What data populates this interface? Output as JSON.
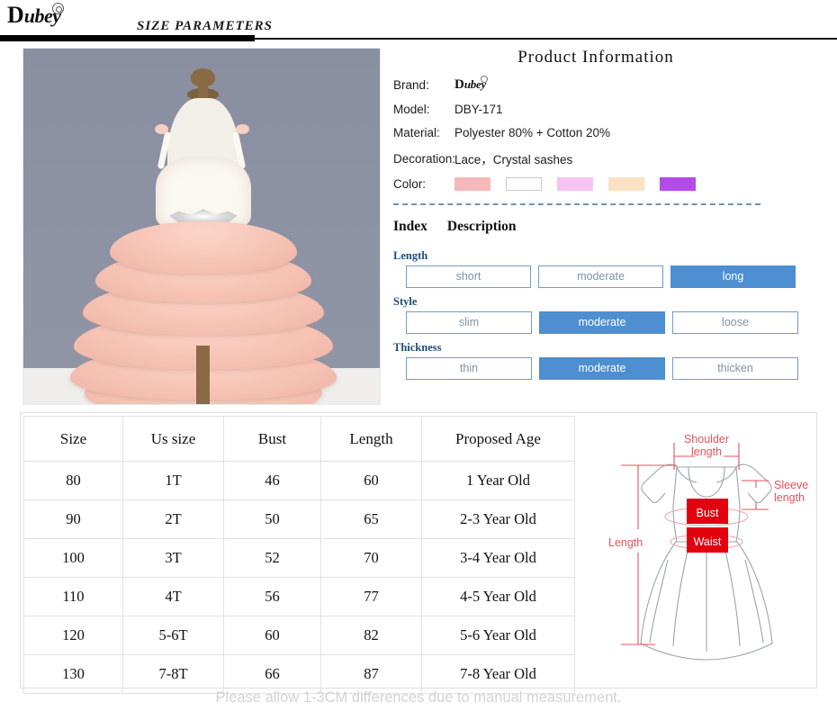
{
  "header": {
    "brand_logo_first": "D",
    "brand_logo_rest": "ubey",
    "title": "SIZE  PARAMETERS"
  },
  "product_image": {
    "alt": "pink tiered tulle flower girl dress on mannequin"
  },
  "product_information": {
    "title": "Product  Information",
    "specs": [
      {
        "label": "Brand:",
        "value": "Dubey",
        "is_logo": true
      },
      {
        "label": "Model:",
        "value": "DBY-171"
      },
      {
        "label": "Material:",
        "value": "Polyester 80% + Cotton 20%"
      },
      {
        "label": "Decoration:",
        "value": "Lace，Crystal sashes"
      }
    ],
    "color_label": "Color:",
    "colors": [
      {
        "name": "pink",
        "hex": "#f6b8bb",
        "border": "#f6b8bb"
      },
      {
        "name": "white",
        "hex": "#ffffff",
        "border": "#c9c9c9"
      },
      {
        "name": "light-magenta",
        "hex": "#f7c3f5",
        "border": "#f7c3f5"
      },
      {
        "name": "peach",
        "hex": "#fbe0c4",
        "border": "#fbe0c4"
      },
      {
        "name": "purple",
        "hex": "#b44ae8",
        "border": "#b44ae8"
      }
    ]
  },
  "index_description": {
    "index_label": "Index",
    "description_label": "Description",
    "groups": [
      {
        "label": "Length",
        "options": [
          {
            "label": "short",
            "selected": false
          },
          {
            "label": "moderate",
            "selected": false
          },
          {
            "label": "long",
            "selected": true
          }
        ]
      },
      {
        "label": "Style",
        "options": [
          {
            "label": "slim",
            "selected": false
          },
          {
            "label": "moderate",
            "selected": true
          },
          {
            "label": "loose",
            "selected": false
          }
        ]
      },
      {
        "label": "Thickness",
        "options": [
          {
            "label": "thin",
            "selected": false
          },
          {
            "label": "moderate",
            "selected": true
          },
          {
            "label": "thicken",
            "selected": false
          }
        ]
      }
    ],
    "accent_color": "#4d8fd1",
    "label_color": "#1f4e79"
  },
  "size_table": {
    "columns": [
      "Size",
      "Us size",
      "Bust",
      "Length",
      "Proposed Age"
    ],
    "rows": [
      [
        "80",
        "1T",
        "46",
        "60",
        "1 Year Old"
      ],
      [
        "90",
        "2T",
        "50",
        "65",
        "2-3 Year Old"
      ],
      [
        "100",
        "3T",
        "52",
        "70",
        "3-4 Year Old"
      ],
      [
        "110",
        "4T",
        "56",
        "77",
        "4-5 Year Old"
      ],
      [
        "120",
        "5-6T",
        "60",
        "82",
        "5-6 Year Old"
      ],
      [
        "130",
        "7-8T",
        "66",
        "87",
        "7-8 Year Old"
      ]
    ]
  },
  "measurement_diagram": {
    "labels": {
      "shoulder": "Shoulder",
      "shoulder2": "length",
      "sleeve": "Sleeve",
      "sleeve2": "length",
      "length": "Length",
      "bust": "Bust",
      "waist": "Waist"
    },
    "line_color": "#e8505b",
    "box_color": "#e3000f"
  },
  "footer": {
    "note": "Please allow 1-3CM differences due to manual measurement."
  }
}
